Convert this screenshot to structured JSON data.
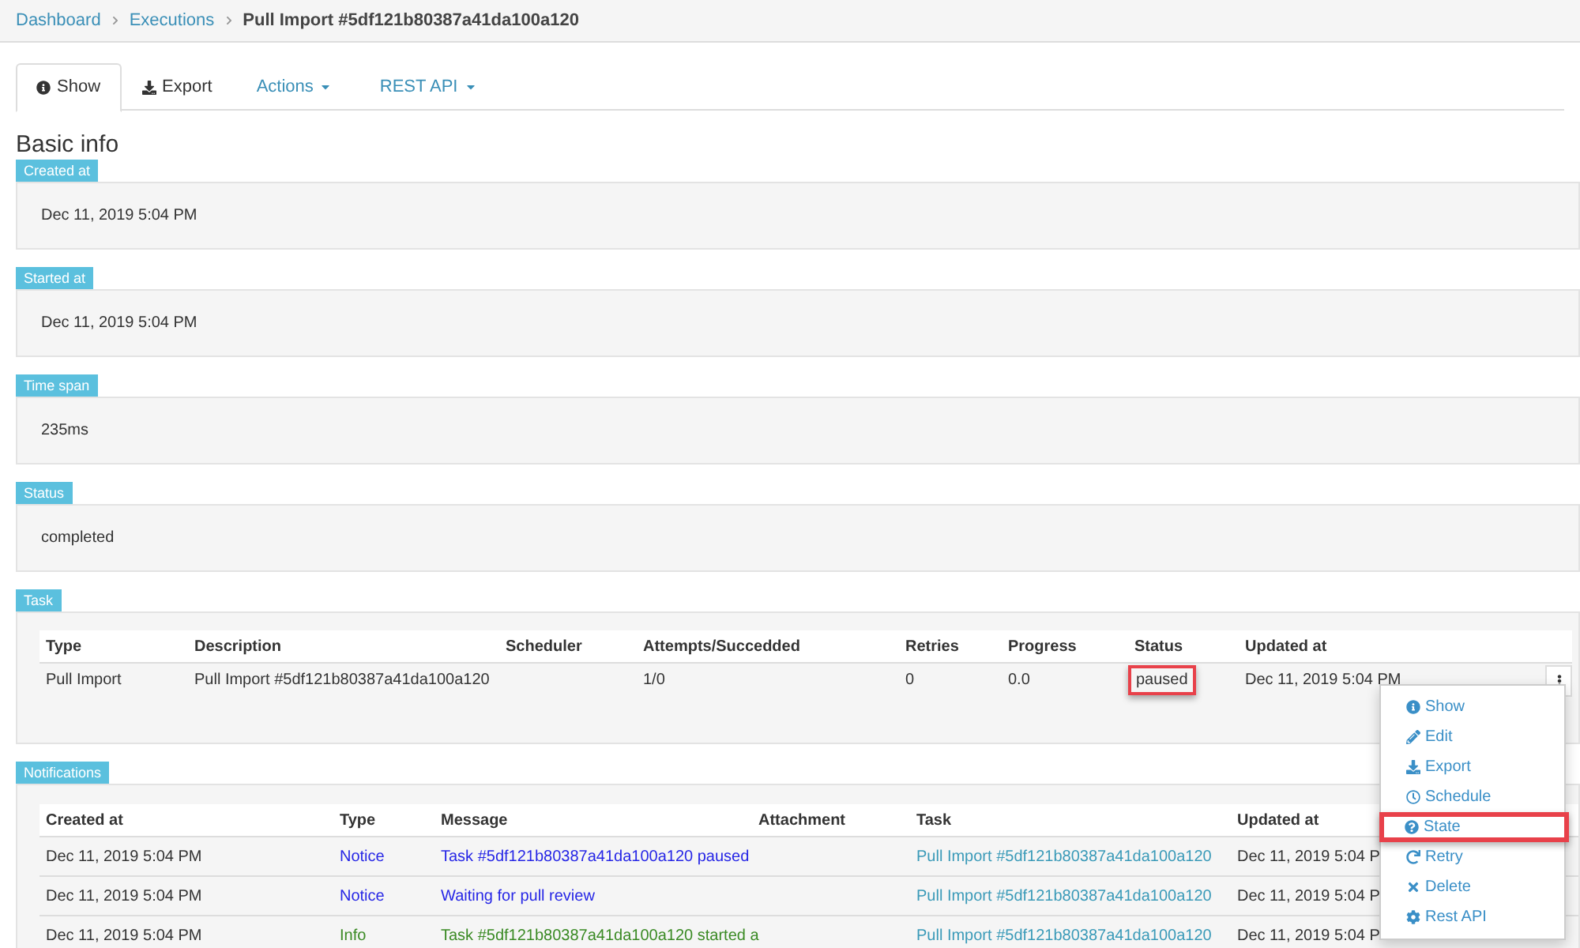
{
  "breadcrumb": [
    {
      "label": "Dashboard",
      "kind": "link"
    },
    {
      "label": "Executions",
      "kind": "link"
    },
    {
      "label": "Pull Import #5df121b80387a41da100a120",
      "kind": "current"
    }
  ],
  "tabs": [
    {
      "label": "Show",
      "kind": "icon",
      "selected": true
    },
    {
      "label": "Export",
      "kind": "icon",
      "selected": false
    },
    {
      "label": "Actions",
      "kind": "dropdown",
      "selected": false
    },
    {
      "label": "REST API",
      "kind": "dropdown",
      "selected": false
    }
  ],
  "section_title": "Basic info",
  "fields": [
    {
      "label": "Created at",
      "value": "Dec 11, 2019 5:04 PM"
    },
    {
      "label": "Started at",
      "value": "Dec 11, 2019 5:04 PM"
    },
    {
      "label": "Time span",
      "value": "235ms"
    },
    {
      "label": "Status",
      "value": "completed"
    }
  ],
  "task": {
    "label": "Task",
    "columns": [
      "Type",
      "Description",
      "Scheduler",
      "Attempts/Succedded",
      "Retries",
      "Progress",
      "Status",
      "Updated at"
    ],
    "rows": [
      {
        "type": "Pull Import",
        "description": "Pull Import #5df121b80387a41da100a120",
        "scheduler": "",
        "attempts": "1/0",
        "retries": "0",
        "progress": "0.0",
        "status": "paused",
        "status_highlighted": true,
        "updated_at": "Dec 11, 2019 5:04 PM"
      }
    ]
  },
  "menu": {
    "items": [
      {
        "label": "Show",
        "highlighted": false
      },
      {
        "label": "Edit",
        "highlighted": false
      },
      {
        "label": "Export",
        "highlighted": false
      },
      {
        "label": "Schedule",
        "highlighted": false
      },
      {
        "label": "State",
        "highlighted": true
      },
      {
        "label": "Retry",
        "highlighted": false
      },
      {
        "label": "Delete",
        "highlighted": false
      },
      {
        "label": "Rest API",
        "highlighted": false
      }
    ]
  },
  "notifications": {
    "label": "Notifications",
    "columns": [
      "Created at",
      "Type",
      "Message",
      "Attachment",
      "Task",
      "Updated at"
    ],
    "rows": [
      {
        "created_at": "Dec 11, 2019 5:04 PM",
        "type": "Notice",
        "message": "Task #5df121b80387a41da100a120 paused",
        "task": "Pull Import #5df121b80387a41da100a120",
        "updated_at": "Dec 11, 2019 5:04 P",
        "color": "#2626e6"
      },
      {
        "created_at": "Dec 11, 2019 5:04 PM",
        "type": "Notice",
        "message": "Waiting for pull review",
        "task": "Pull Import #5df121b80387a41da100a120",
        "updated_at": "Dec 11, 2019 5:04 P",
        "color": "#2626e6"
      },
      {
        "created_at": "Dec 11, 2019 5:04 PM",
        "type": "Info",
        "message": "Task #5df121b80387a41da100a120 started a",
        "task": "Pull Import #5df121b80387a41da100a120",
        "updated_at": "Dec 11, 2019 5:04 P",
        "color": "#3a8a24"
      }
    ]
  }
}
